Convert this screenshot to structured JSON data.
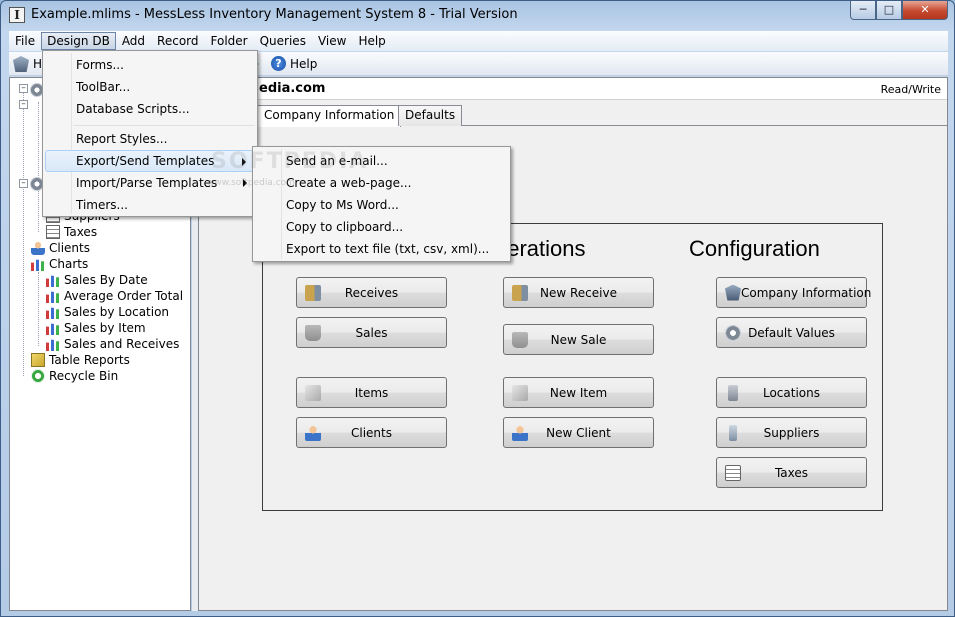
{
  "window": {
    "title": "Example.mlims - MessLess Inventory Management System 8 - Trial Version",
    "app_icon": "I",
    "buttons": [
      "minimize-icon",
      "maximize-icon",
      "close-icon"
    ]
  },
  "menubar": {
    "items": [
      "File",
      "Design DB",
      "Add",
      "Record",
      "Folder",
      "Queries",
      "View",
      "Help"
    ]
  },
  "toolbar": {
    "partial_label": "H",
    "help_label": "Help"
  },
  "design_db_menu": {
    "items": [
      "Forms...",
      "ToolBar...",
      "Database Scripts...",
      "Report Styles...",
      "Export/Send Templates",
      "Import/Parse Templates",
      "Timers..."
    ]
  },
  "export_submenu": {
    "items": [
      "Send an e-mail...",
      "Create a web-page...",
      "Copy to Ms Word...",
      "Copy to clipboard...",
      "Export to text file (txt, csv, xml)..."
    ]
  },
  "tree": {
    "items": [
      {
        "label": "Suppliers",
        "icon": "phone-icon"
      },
      {
        "label": "Taxes",
        "icon": "calculator-icon"
      },
      {
        "label": "Clients",
        "icon": "person-icon"
      },
      {
        "label": "Charts",
        "icon": "chart-icon"
      },
      {
        "label": "Sales By Date",
        "icon": "chart-icon"
      },
      {
        "label": "Average Order Total",
        "icon": "chart-icon"
      },
      {
        "label": "Sales by Location",
        "icon": "chart-icon"
      },
      {
        "label": "Sales by Item",
        "icon": "chart-icon"
      },
      {
        "label": "Sales and Receives",
        "icon": "chart-icon"
      },
      {
        "label": "Table Reports",
        "icon": "report-icon"
      },
      {
        "label": "Recycle Bin",
        "icon": "recycle-icon"
      }
    ]
  },
  "main": {
    "company_name": "edia.com",
    "access_mode": "Read/Write",
    "tabs": [
      "Company Information",
      "Defaults"
    ],
    "operations_title": "perations",
    "configuration_title": "Configuration",
    "col1_buttons": [
      "Receives",
      "Sales",
      "Items",
      "Clients"
    ],
    "col2_buttons": [
      "New Receive",
      "New Sale",
      "New Item",
      "New Client"
    ],
    "col3_buttons": [
      "Company Information",
      "Default Values",
      "Locations",
      "Suppliers",
      "Taxes"
    ]
  },
  "watermark": {
    "text": "SOFTPEDIA",
    "url": "www.softpedia.com"
  }
}
